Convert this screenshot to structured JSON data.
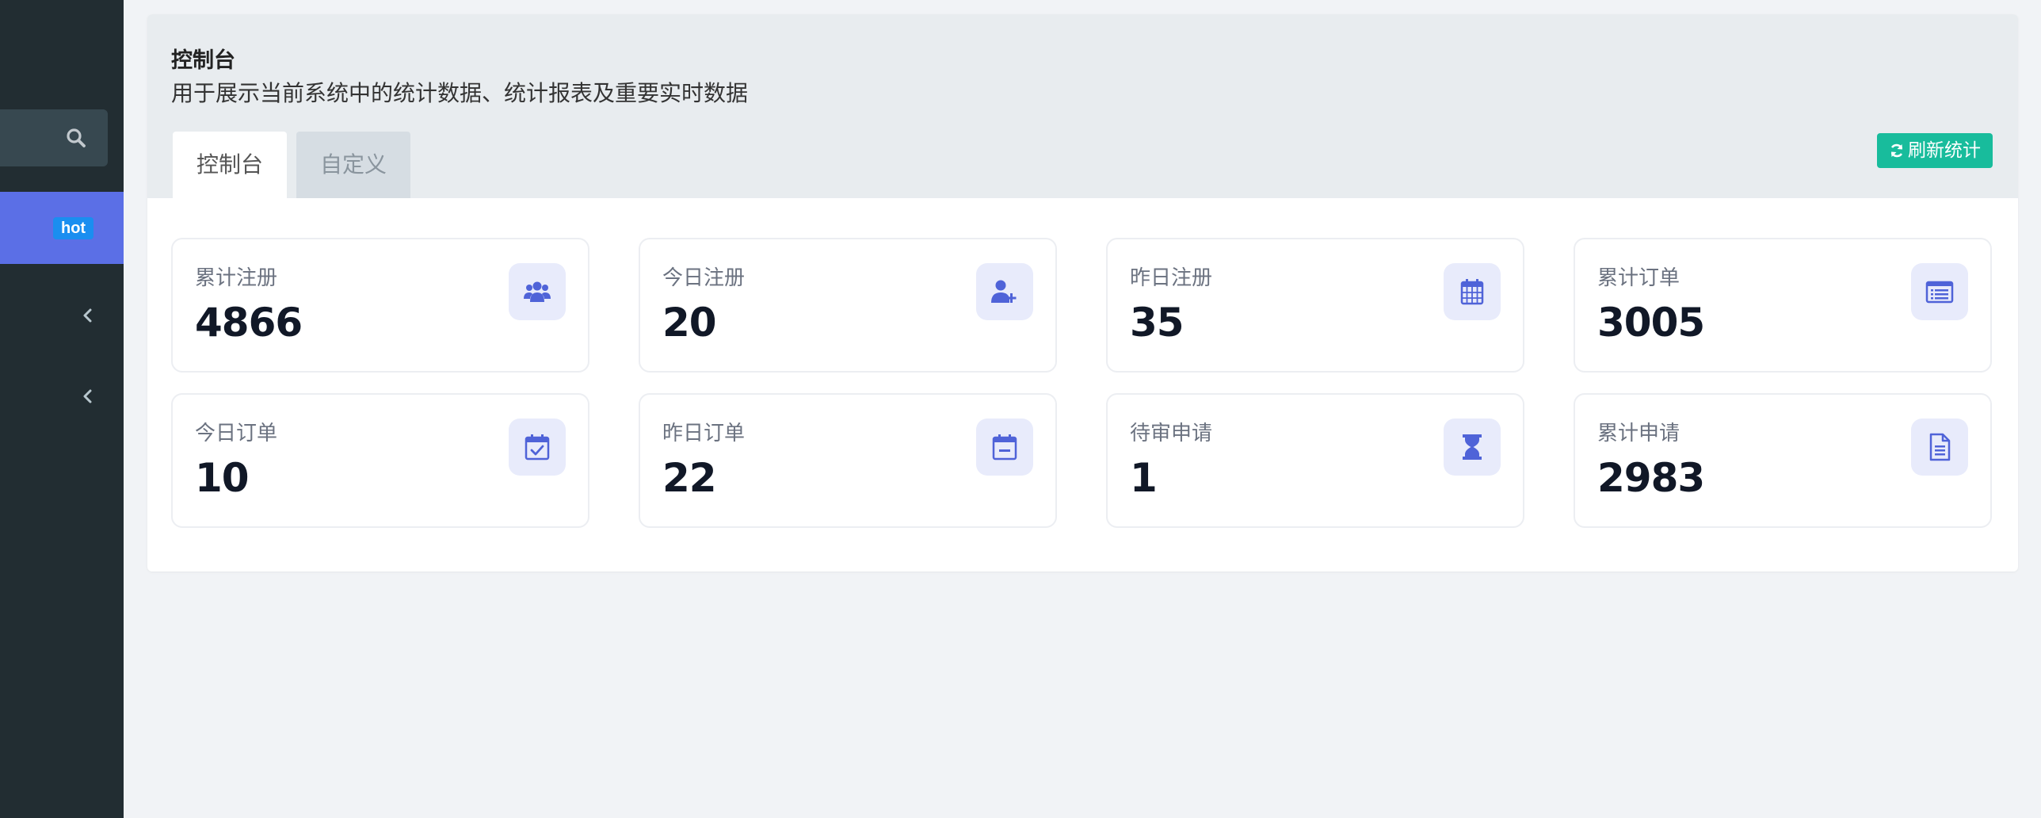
{
  "sidebar": {
    "hot_badge": "hot"
  },
  "header": {
    "title": "控制台",
    "description": "用于展示当前系统中的统计数据、统计报表及重要实时数据"
  },
  "tabs": [
    {
      "label": "控制台",
      "active": true
    },
    {
      "label": "自定义",
      "active": false
    }
  ],
  "refresh_button": "刷新统计",
  "stats": [
    {
      "label": "累计注册",
      "value": "4866",
      "icon": "users-icon"
    },
    {
      "label": "今日注册",
      "value": "20",
      "icon": "user-plus-icon"
    },
    {
      "label": "昨日注册",
      "value": "35",
      "icon": "calendar-icon"
    },
    {
      "label": "累计订单",
      "value": "3005",
      "icon": "list-alt-icon"
    },
    {
      "label": "今日订单",
      "value": "10",
      "icon": "calendar-check-icon"
    },
    {
      "label": "昨日订单",
      "value": "22",
      "icon": "calendar-minus-icon"
    },
    {
      "label": "待审申请",
      "value": "1",
      "icon": "hourglass-icon"
    },
    {
      "label": "累计申请",
      "value": "2983",
      "icon": "file-text-icon"
    }
  ],
  "colors": {
    "sidebar_bg": "#222d32",
    "accent": "#5b6fe6",
    "success": "#18bc9c",
    "badge": "#1a8ef0"
  }
}
